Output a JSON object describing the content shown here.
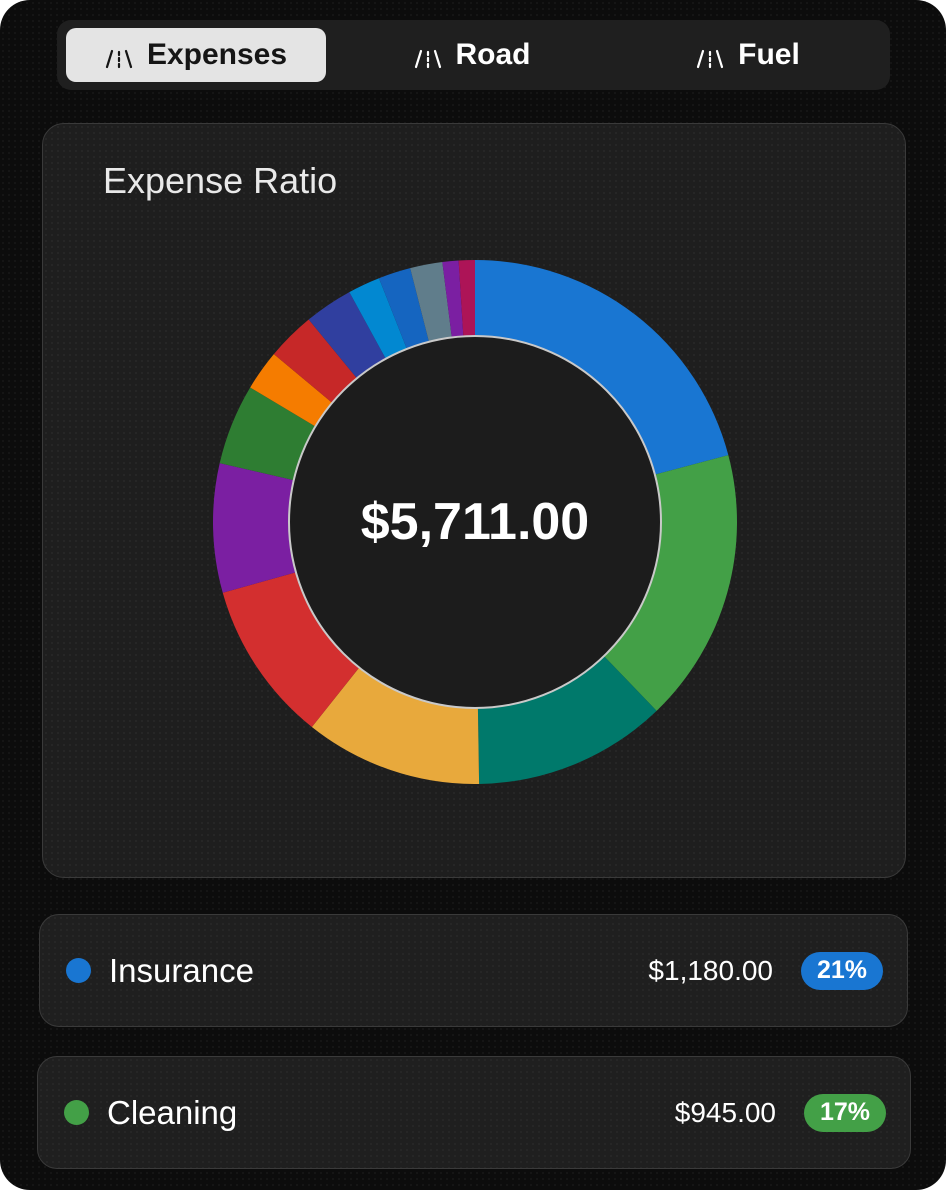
{
  "tabs": [
    {
      "label": "Expenses",
      "icon": "road-icon",
      "active": true
    },
    {
      "label": "Road",
      "icon": "road-icon",
      "active": false
    },
    {
      "label": "Fuel",
      "icon": "road-icon",
      "active": false
    }
  ],
  "card": {
    "title": "Expense Ratio",
    "total": "$5,711.00"
  },
  "chart_data": {
    "type": "pie",
    "title": "Expense Ratio",
    "values": [
      21,
      17,
      12,
      11,
      10,
      8,
      5,
      2.5,
      3,
      3,
      2,
      2,
      2,
      1,
      1
    ],
    "colors": [
      "#1976d2",
      "#43a047",
      "#00796b",
      "#e8a93c",
      "#d32f2f",
      "#7b1fa2",
      "#2e7d32",
      "#f57c00",
      "#c62828",
      "#303f9f",
      "#0288d1",
      "#1565c0",
      "#607d8b",
      "#7b1fa2",
      "#ad1457"
    ]
  },
  "expenses": [
    {
      "name": "Insurance",
      "amount": "$1,180.00",
      "percent": "21%",
      "color": "#1976d2"
    },
    {
      "name": "Cleaning",
      "amount": "$945.00",
      "percent": "17%",
      "color": "#43a047"
    }
  ]
}
